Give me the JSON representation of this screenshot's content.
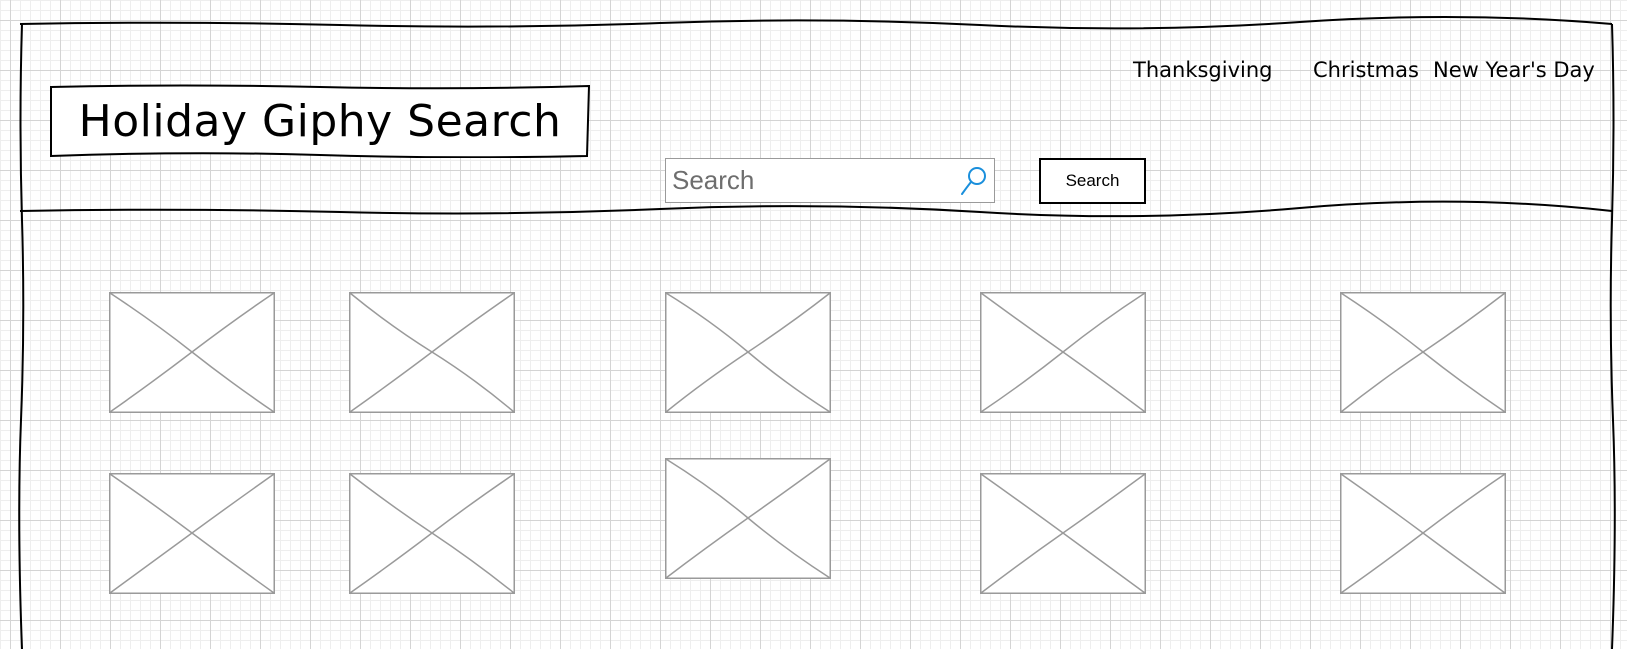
{
  "header": {
    "title": "Holiday Giphy Search"
  },
  "nav": {
    "items": [
      {
        "label": "Thanksgiving"
      },
      {
        "label": "Christmas"
      },
      {
        "label": "New Year's Day"
      }
    ]
  },
  "search": {
    "value": "",
    "placeholder": "Search",
    "button_label": "Search",
    "icon": "search-icon"
  },
  "results": {
    "image_count": 10,
    "icon": "image-placeholder-icon"
  },
  "colors": {
    "accent": "#1a8fdc",
    "placeholder_stroke": "#9a9a9a",
    "frame_stroke": "#000000"
  }
}
